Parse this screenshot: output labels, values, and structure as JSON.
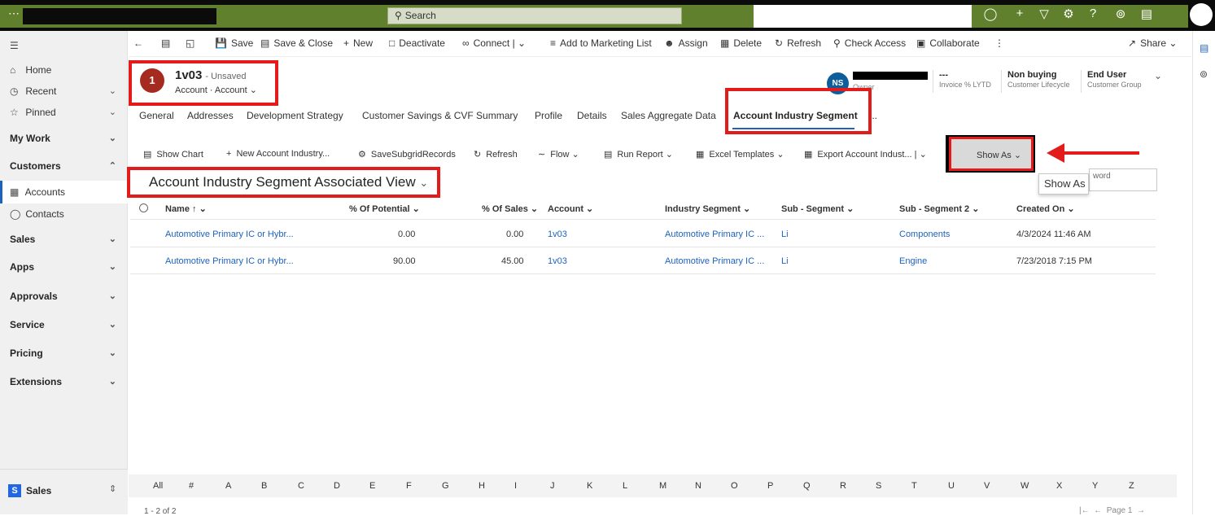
{
  "topbar": {
    "waffle_icon": "waffle-icon",
    "app_name": "",
    "search_placeholder": "Search",
    "icons": [
      "lightbulb-icon",
      "plus-icon",
      "filter-icon",
      "gear-icon",
      "help-icon",
      "copilot-icon",
      "chat-icon"
    ]
  },
  "nav": {
    "items": [
      {
        "label": "Home",
        "icon": "home-icon"
      },
      {
        "label": "Recent",
        "icon": "clock-icon"
      },
      {
        "label": "Pinned",
        "icon": "pin-icon"
      }
    ],
    "groups": [
      {
        "label": "My Work"
      },
      {
        "label": "Customers"
      },
      {
        "label": "Sales"
      },
      {
        "label": "Apps"
      },
      {
        "label": "Approvals"
      },
      {
        "label": "Service"
      },
      {
        "label": "Pricing"
      },
      {
        "label": "Extensions"
      }
    ],
    "customers_items": [
      {
        "label": "Accounts"
      },
      {
        "label": "Contacts"
      }
    ],
    "area": {
      "badge": "S",
      "label": "Sales"
    }
  },
  "commands": {
    "save": "Save",
    "save_close": "Save & Close",
    "new": "New",
    "deactivate": "Deactivate",
    "connect": "Connect",
    "add_marketing": "Add to Marketing List",
    "assign": "Assign",
    "delete": "Delete",
    "refresh": "Refresh",
    "check_access": "Check Access",
    "collaborate": "Collaborate",
    "share": "Share"
  },
  "record": {
    "badge": "1",
    "title": "1v03",
    "unsaved": "- Unsaved",
    "entity": "Account",
    "form": "Account",
    "owner_initials": "NS",
    "owner_label": "Owner",
    "fields": [
      {
        "value": "---",
        "label": "Invoice % LYTD"
      },
      {
        "value": "Non buying",
        "label": "Customer Lifecycle"
      },
      {
        "value": "End User",
        "label": "Customer Group"
      }
    ]
  },
  "tabs": [
    "General",
    "Addresses",
    "Development Strategy",
    "Customer Savings & CVF Summary",
    "Profile",
    "Details",
    "Sales Aggregate Data",
    "Account Industry Segment",
    "..."
  ],
  "subgrid_commands": {
    "show_chart": "Show Chart",
    "new_segment": "New Account Industry...",
    "save_subgrid": "SaveSubgridRecords",
    "refresh": "Refresh",
    "flow": "Flow",
    "run_report": "Run Report",
    "excel_templates": "Excel Templates",
    "export": "Export Account Indust...",
    "show_as": "Show As",
    "tooltip": "Show As",
    "search_partial": "word"
  },
  "view": {
    "title": "Account Industry Segment Associated View"
  },
  "grid": {
    "columns": [
      "Name ↑",
      "% Of Potential",
      "% Of Sales",
      "Account",
      "Industry Segment",
      "Sub - Segment",
      "Sub - Segment 2",
      "Created On"
    ],
    "rows": [
      [
        "Automotive Primary IC or Hybr...",
        "0.00",
        "0.00",
        "1v03",
        "Automotive Primary IC ...",
        "Li",
        "Components",
        "4/3/2024 11:46 AM"
      ],
      [
        "Automotive Primary IC or Hybr...",
        "90.00",
        "45.00",
        "1v03",
        "Automotive Primary IC ...",
        "Li",
        "Engine",
        "7/23/2018 7:15 PM"
      ]
    ]
  },
  "alphabet": [
    "All",
    "#",
    "A",
    "B",
    "C",
    "D",
    "E",
    "F",
    "G",
    "H",
    "I",
    "J",
    "K",
    "L",
    "M",
    "N",
    "O",
    "P",
    "Q",
    "R",
    "S",
    "T",
    "U",
    "V",
    "W",
    "X",
    "Y",
    "Z"
  ],
  "footer": {
    "count": "1 - 2 of 2",
    "page": "Page 1"
  },
  "colors": {
    "brand_green": "#60802e",
    "highlight_red": "#e31b1b",
    "link_blue": "#1d62bf",
    "avatar_red": "#a52a1f",
    "owner_blue": "#0f5e9c"
  }
}
